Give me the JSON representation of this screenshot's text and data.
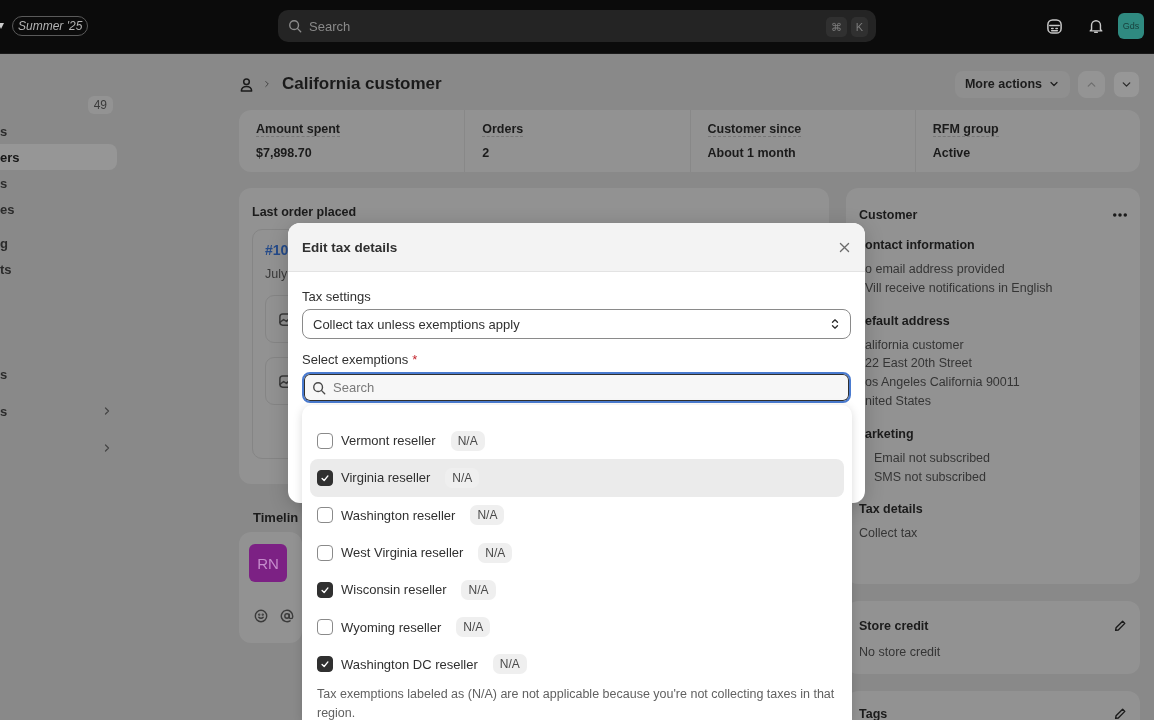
{
  "topbar": {
    "release_badge": "Summer '25",
    "search": {
      "placeholder": "Search",
      "shortcut_keys": [
        "⌘",
        "K"
      ]
    },
    "avatar": {
      "initials": "Gds"
    }
  },
  "sidebar": {
    "groups": [
      [
        {
          "badge": "49",
          "selected": false
        },
        {
          "label": "s",
          "selected": false
        },
        {
          "label": "ers",
          "selected": true
        },
        {
          "label": "s",
          "selected": false
        },
        {
          "label": "es",
          "selected": false
        }
      ],
      [
        {
          "label": "g",
          "selected": false
        },
        {
          "label": "ts",
          "selected": false
        }
      ],
      [
        {
          "label": "s",
          "selected": false
        },
        {
          "label": "s",
          "selected": false,
          "expandable": true
        },
        {
          "selected": false,
          "expandable": true
        }
      ]
    ]
  },
  "page_header": {
    "title": "California customer",
    "more_actions": "More actions",
    "nav": [
      {
        "kind": "previous",
        "disabled": true
      },
      {
        "kind": "next",
        "disabled": false
      }
    ]
  },
  "stats": [
    {
      "label": "Amount spent",
      "value": "$7,898.70"
    },
    {
      "label": "Orders",
      "value": "2"
    },
    {
      "label": "Customer since",
      "value": "About 1 month"
    },
    {
      "label": "RFM group",
      "value": "Active"
    }
  ],
  "last_order": {
    "title": "Last order placed",
    "order_number": "#10",
    "date": "July"
  },
  "timeline": {
    "title": "Timelin",
    "entry": {
      "initials": "RN"
    }
  },
  "customer_card": {
    "title": "Customer",
    "sections": [
      {
        "kind": "text",
        "heading": "ontact information",
        "lines": [
          "o email address provided",
          "Vill receive notifications in English"
        ]
      },
      {
        "kind": "text",
        "heading": "efault address",
        "lines": [
          "alifornia customer",
          "22 East 20th Street",
          "os Angeles California 90011",
          "nited States"
        ]
      },
      {
        "kind": "subscription",
        "heading": "arketing",
        "lines": [
          "Email not subscribed",
          "SMS not subscribed"
        ]
      },
      {
        "kind": "full",
        "heading": "Tax details",
        "lines": [
          "Collect tax"
        ]
      }
    ]
  },
  "store_credit": {
    "title": "Store credit",
    "text": "No store credit"
  },
  "tags": {
    "title": "Tags"
  },
  "modal": {
    "title": "Edit tax details",
    "tax_settings_label": "Tax settings",
    "tax_setting": "Collect tax unless exemptions apply",
    "exemptions_label": "Select exemptions",
    "required_mark": "*",
    "search": {
      "placeholder": "Search",
      "focused": true
    }
  },
  "exemptions": {
    "options": [
      {
        "label": "Vermont reseller",
        "badge": "N/A",
        "checked": false,
        "selected": false
      },
      {
        "label": "Virginia reseller",
        "badge": "N/A",
        "checked": true,
        "selected": true
      },
      {
        "label": "Washington reseller",
        "badge": "N/A",
        "checked": false,
        "selected": false
      },
      {
        "label": "West Virginia reseller",
        "badge": "N/A",
        "checked": false,
        "selected": false
      },
      {
        "label": "Wisconsin reseller",
        "badge": "N/A",
        "checked": true,
        "selected": false
      },
      {
        "label": "Wyoming reseller",
        "badge": "N/A",
        "checked": false,
        "selected": false
      },
      {
        "label": "Washington DC reseller",
        "badge": "N/A",
        "checked": true,
        "selected": false
      }
    ],
    "footnote": "Tax exemptions labeled as (N/A) are not applicable because you're not collecting taxes in that region."
  }
}
